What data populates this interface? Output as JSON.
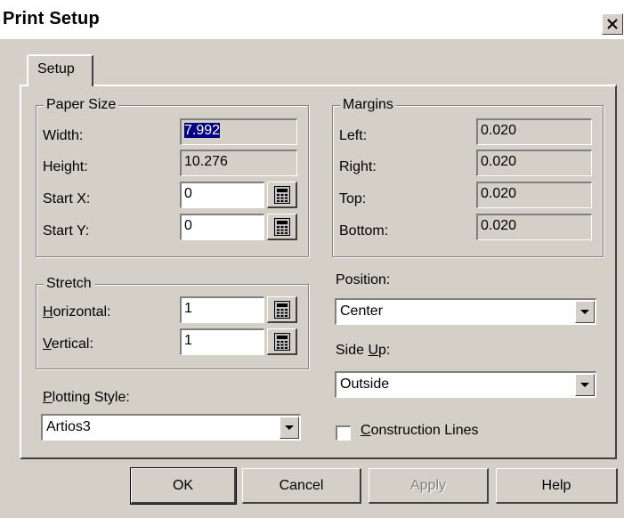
{
  "window": {
    "title": "Print Setup",
    "close_glyph": "✕"
  },
  "tabs": [
    {
      "label": "Setup"
    }
  ],
  "paper_size": {
    "legend": "Paper Size",
    "width_label": "Width:",
    "width_value": "7.992",
    "height_label": "Height:",
    "height_value": "10.276",
    "startx_label": "Start X:",
    "startx_value": "0",
    "starty_label": "Start Y:",
    "starty_value": "0"
  },
  "margins": {
    "legend": "Margins",
    "left_label": "Left:",
    "left_value": "0.020",
    "right_label": "Right:",
    "right_value": "0.020",
    "top_label": "Top:",
    "top_value": "0.020",
    "bottom_label": "Bottom:",
    "bottom_value": "0.020"
  },
  "stretch": {
    "legend": "Stretch",
    "horizontal_label": "Horizontal:",
    "horizontal_mnemonic": "H",
    "horizontal_rest": "orizontal:",
    "horizontal_value": "1",
    "vertical_label": "Vertical:",
    "vertical_mnemonic": "V",
    "vertical_rest": "ertical:",
    "vertical_value": "1"
  },
  "plotting_style": {
    "label": "Plotting Style:",
    "mnemonic": "P",
    "rest": "lotting Style:",
    "value": "Artios3"
  },
  "position": {
    "label": "Position:",
    "value": "Center"
  },
  "side_up": {
    "label": "Side Up:",
    "prefix": "Side ",
    "mnemonic": "U",
    "rest": "p:",
    "value": "Outside"
  },
  "construction_lines": {
    "label": "Construction Lines",
    "mnemonic": "C",
    "rest": "onstruction Lines",
    "checked": false
  },
  "buttons": {
    "ok": "OK",
    "cancel": "Cancel",
    "apply": "Apply",
    "help": "Help"
  },
  "icons": {
    "calculator": "calculator-icon",
    "dropdown": "chevron-down-icon",
    "close": "close-icon"
  }
}
